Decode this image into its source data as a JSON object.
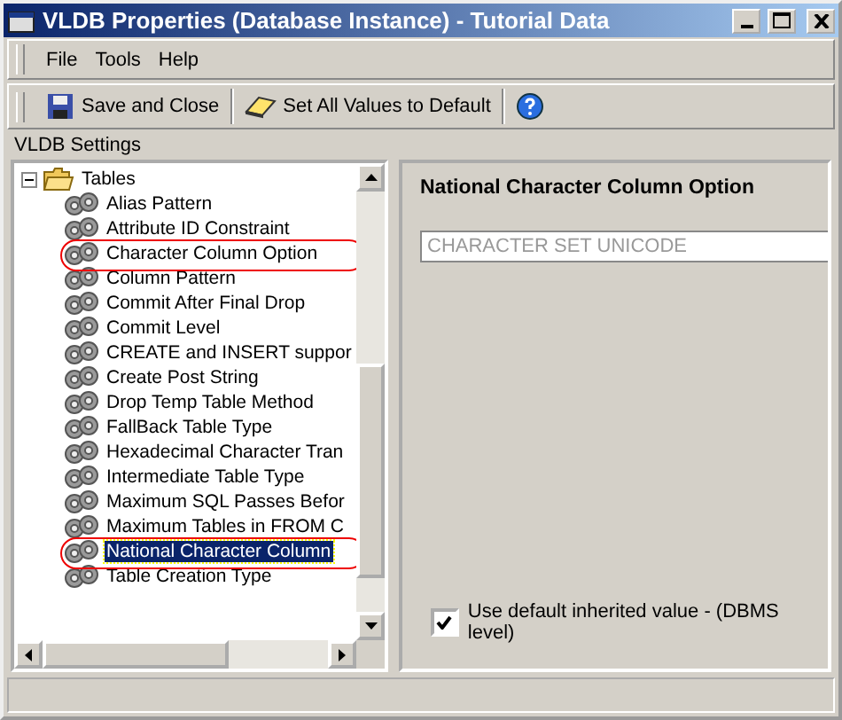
{
  "window": {
    "title": "VLDB Properties (Database Instance) - Tutorial Data"
  },
  "menu": [
    {
      "label": "File"
    },
    {
      "label": "Tools"
    },
    {
      "label": "Help"
    }
  ],
  "toolbar": [
    {
      "kind": "save",
      "label": "Save and Close"
    },
    {
      "kind": "eraser",
      "label": "Set All Values to Default"
    },
    {
      "kind": "help"
    }
  ],
  "section_label": "VLDB Settings",
  "tree": {
    "label": "Tables",
    "expanded": true,
    "children": [
      {
        "label": "Alias Pattern",
        "selected": false,
        "circled": false
      },
      {
        "label": "Attribute ID Constraint",
        "selected": false,
        "circled": false
      },
      {
        "label": "Character Column Option",
        "selected": false,
        "circled": true
      },
      {
        "label": "Column Pattern",
        "selected": false,
        "circled": false
      },
      {
        "label": "Commit After Final Drop",
        "selected": false,
        "circled": false
      },
      {
        "label": "Commit Level",
        "selected": false,
        "circled": false
      },
      {
        "label": "CREATE and INSERT suppor",
        "selected": false,
        "circled": false
      },
      {
        "label": "Create Post String",
        "selected": false,
        "circled": false
      },
      {
        "label": "Drop Temp Table Method",
        "selected": false,
        "circled": false
      },
      {
        "label": "FallBack Table Type",
        "selected": false,
        "circled": false
      },
      {
        "label": "Hexadecimal Character Tran",
        "selected": false,
        "circled": false
      },
      {
        "label": "Intermediate Table Type",
        "selected": false,
        "circled": false
      },
      {
        "label": "Maximum SQL Passes Befor",
        "selected": false,
        "circled": false
      },
      {
        "label": "Maximum Tables in FROM C",
        "selected": false,
        "circled": false
      },
      {
        "label": "National Character Column",
        "selected": true,
        "circled": true
      },
      {
        "label": "Table Creation Type",
        "selected": false,
        "circled": false
      }
    ]
  },
  "detail": {
    "title": "National Character Column Option",
    "value": "CHARACTER SET UNICODE",
    "disabled": true
  },
  "inherit_checkbox": {
    "label": "Use default inherited value - (DBMS level)",
    "checked": true
  }
}
